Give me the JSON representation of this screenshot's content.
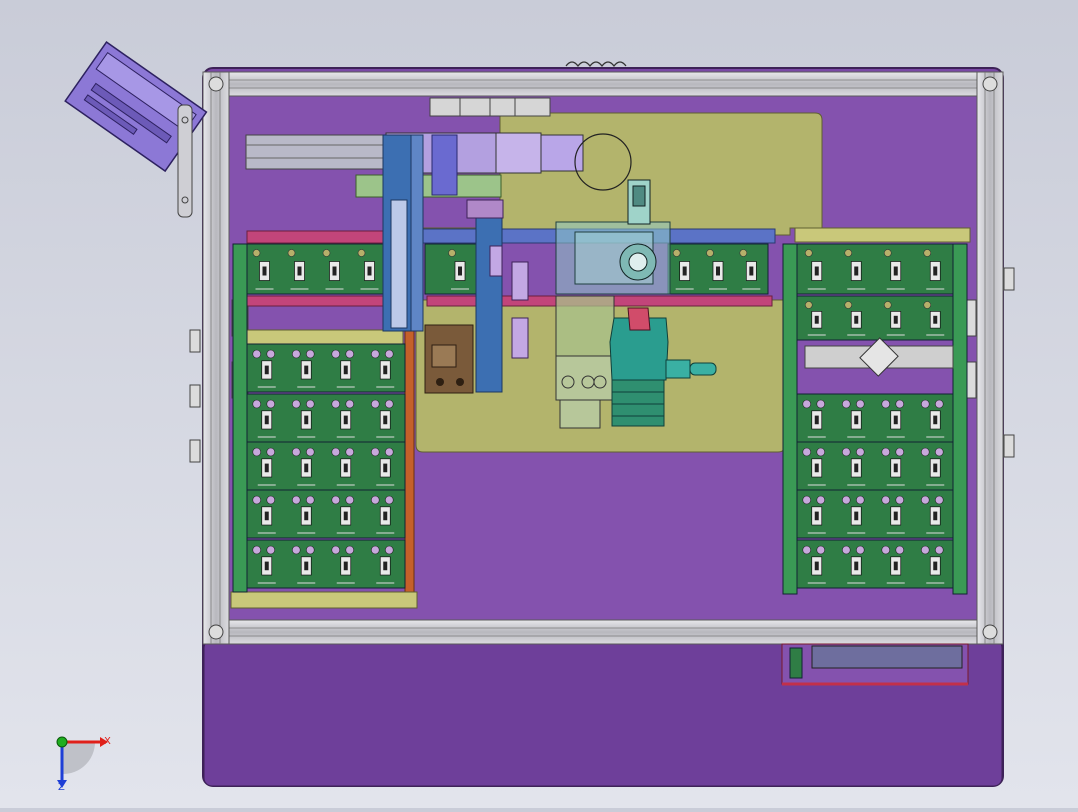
{
  "triad": {
    "x_label": "X",
    "z_label": "Z"
  },
  "colors": {
    "background_top": "#c9ccd8",
    "background_bottom": "#dfe1ea",
    "base_plate": "#7a49a6",
    "base_plate_edge": "#3e2258",
    "frame_aluminum": "#c8c8cc",
    "frame_line": "#5a5a5a",
    "olive_plate": "#b3b46c",
    "green_pcb": "#2f7d45",
    "pcb_hole": "#c7a8dc",
    "pcb_pad": "#b7b06a",
    "blue_column": "#3c6fb2",
    "teal_motor": "#2a9d8f",
    "pink_rail": "#c2457a",
    "orange_strip": "#c5602a",
    "brown_bracket": "#7a5a3a",
    "lilac_housing": "#8c78d6",
    "axis_x": "#e0201a",
    "axis_y": "#1fae1f",
    "axis_z": "#1e3fd6"
  }
}
